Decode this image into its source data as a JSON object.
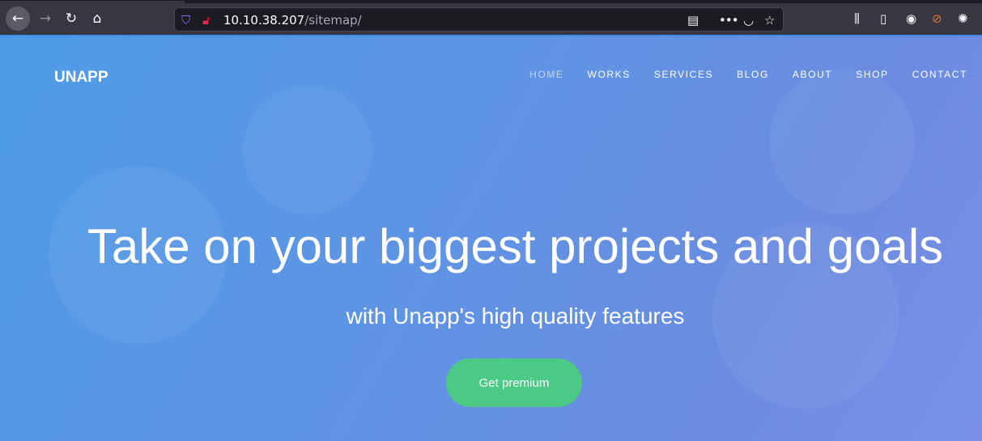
{
  "browser": {
    "url_host": "10.10.38.207",
    "url_path": "/sitemap/"
  },
  "site": {
    "logo": "UNAPP",
    "nav": [
      "HOME",
      "WORKS",
      "SERVICES",
      "BLOG",
      "ABOUT",
      "SHOP",
      "CONTACT"
    ],
    "active_nav": "HOME",
    "headline": "Take on your biggest projects and goals",
    "subheadline": "with Unapp's high quality features",
    "cta": "Get premium"
  },
  "colors": {
    "accent": "#4bc985",
    "hero_start": "#4d9be6",
    "hero_end": "#7a90e8"
  }
}
